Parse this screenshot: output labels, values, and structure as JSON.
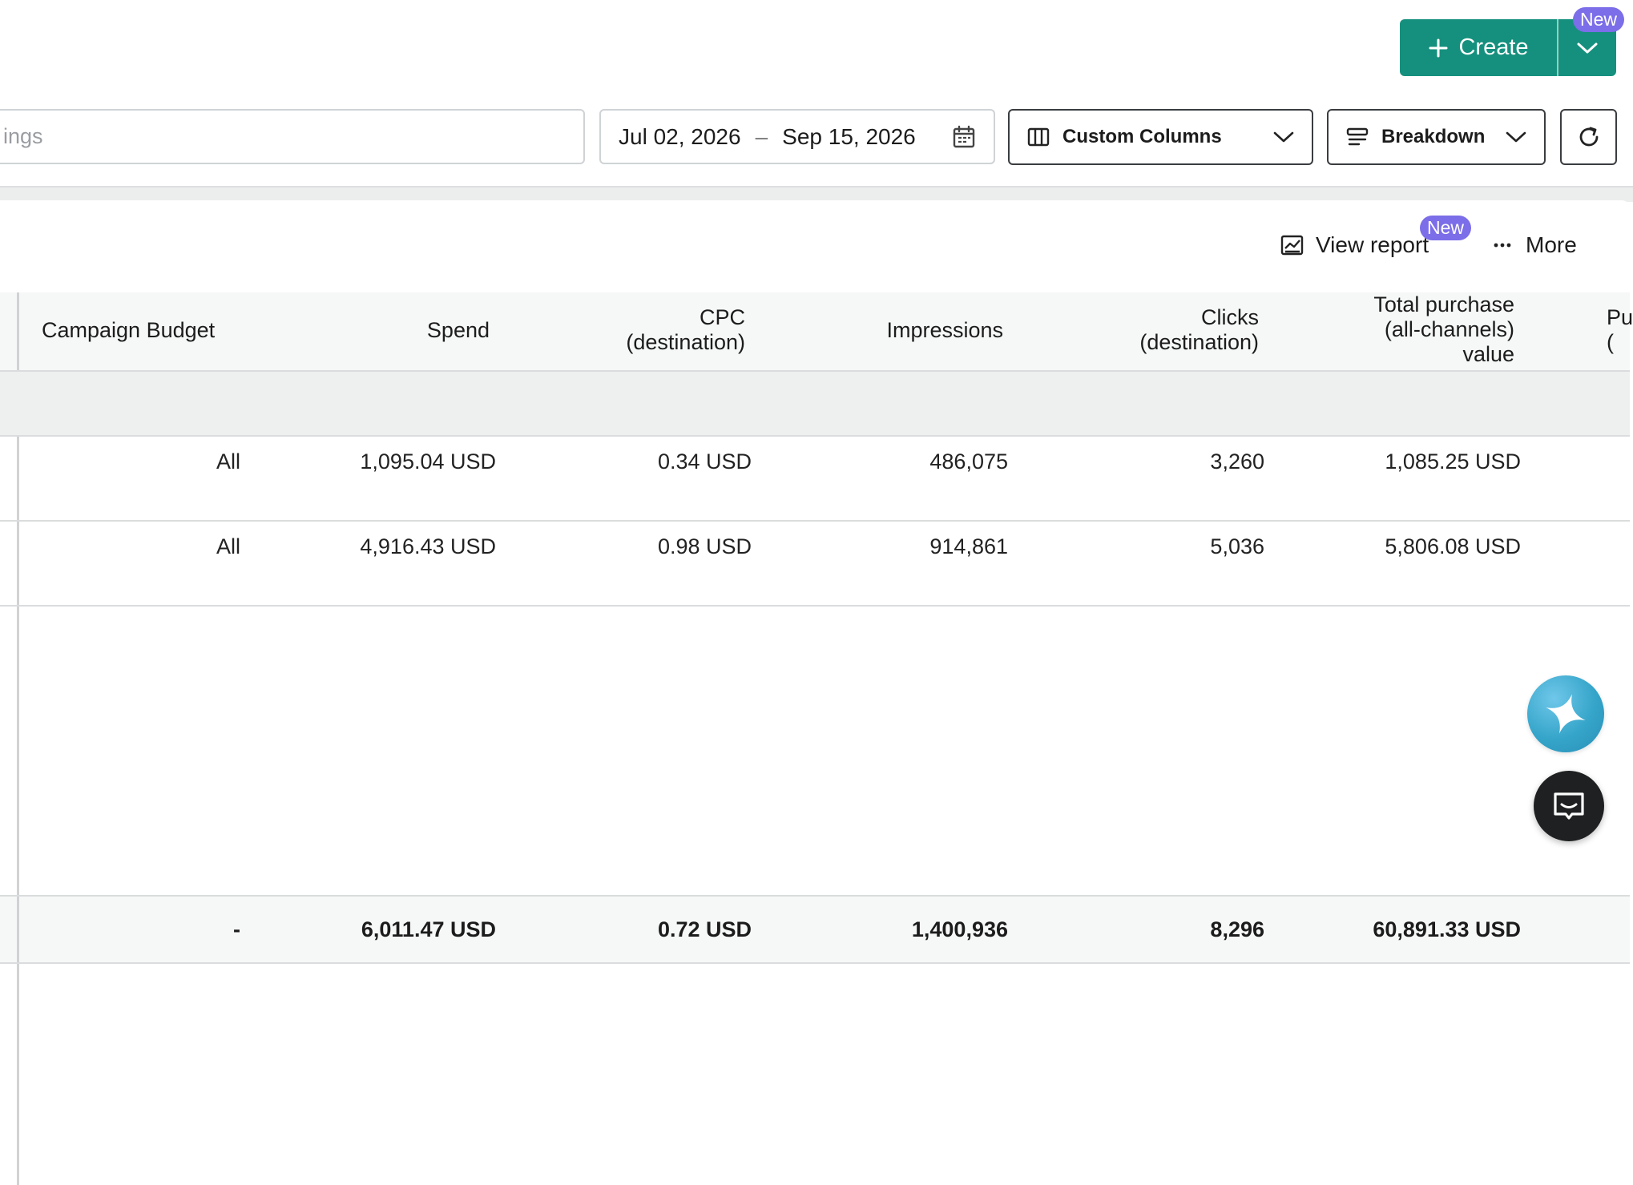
{
  "toolbar": {
    "create_label": "Create",
    "create_badge": "New",
    "search_placeholder": "ings",
    "date_start": "Jul 02, 2026",
    "date_separator": "–",
    "date_end": "Sep 15, 2026",
    "custom_columns_label": "Custom Columns",
    "breakdown_label": "Breakdown"
  },
  "panel": {
    "view_report_label": "View report",
    "view_report_badge": "New",
    "more_label": "More"
  },
  "table": {
    "headers": {
      "campaign_budget": "Campaign Budget",
      "spend": "Spend",
      "cpc_line1": "CPC",
      "cpc_line2": "(destination)",
      "impressions": "Impressions",
      "clicks_line1": "Clicks",
      "clicks_line2": "(destination)",
      "tpv_line1": "Total purchase",
      "tpv_line2": "(all-channels)",
      "tpv_line3": "value",
      "next_col_partial_1": "Pu",
      "next_col_partial_2": "("
    },
    "rows": [
      {
        "campaign_budget": "All",
        "spend": "1,095.04 USD",
        "cpc": "0.34 USD",
        "impressions": "486,075",
        "clicks": "3,260",
        "total_purchase_value": "1,085.25 USD"
      },
      {
        "campaign_budget": "All",
        "spend": "4,916.43 USD",
        "cpc": "0.98 USD",
        "impressions": "914,861",
        "clicks": "5,036",
        "total_purchase_value": "5,806.08 USD"
      }
    ],
    "totals": {
      "campaign_budget": "-",
      "spend": "6,011.47 USD",
      "cpc": "0.72 USD",
      "impressions": "1,400,936",
      "clicks": "8,296",
      "total_purchase_value": "60,891.33 USD"
    }
  },
  "colors": {
    "accent": "#16907e",
    "badge": "#7b6ee8"
  }
}
